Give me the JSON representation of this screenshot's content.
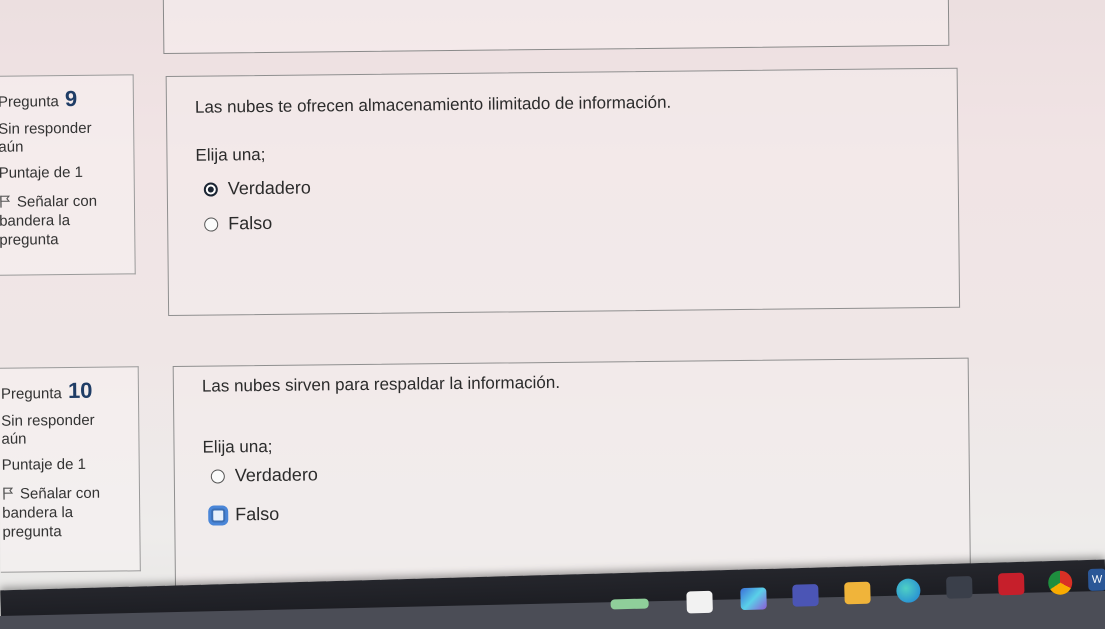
{
  "questions": [
    {
      "label": "Pregunta",
      "number": "9",
      "state": "Sin responder aún",
      "mark": "Puntaje de 1",
      "flag": "Señalar con bandera la pregunta",
      "text": "Las nubes te ofrecen almacenamiento ilimitado de información.",
      "prompt": "Elija una;",
      "options": [
        {
          "label": "Verdadero",
          "selected": true
        },
        {
          "label": "Falso",
          "selected": false
        }
      ]
    },
    {
      "label": "Pregunta",
      "number": "10",
      "state": "Sin responder aún",
      "mark": "Puntaje de 1",
      "flag": "Señalar con bandera la pregunta",
      "text": "Las nubes sirven para respaldar la información.",
      "prompt": "Elija una;",
      "options": [
        {
          "label": "Verdadero",
          "selected": false
        },
        {
          "label": "Falso",
          "selected": false,
          "focused": true
        }
      ]
    }
  ],
  "taskbar": {
    "icons": [
      "taskbar-app-icon",
      "file-explorer-icon",
      "teams-icon",
      "folder-icon",
      "edge-browser-icon",
      "store-icon",
      "mcafee-icon",
      "chrome-icon",
      "word-icon"
    ],
    "visible_text": "W"
  },
  "colors": {
    "question_number": "#1f3d66",
    "focus_ring": "#4a86d8"
  }
}
